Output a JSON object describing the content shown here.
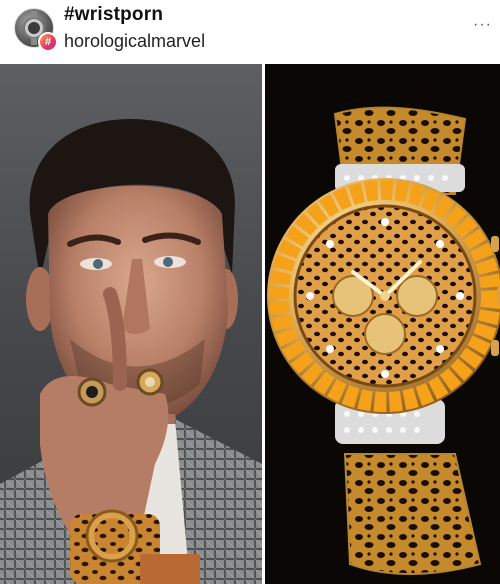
{
  "post": {
    "hashtag": "#wristporn",
    "username": "horologicalmarvel",
    "badge_symbol": "#",
    "more_glyph": "···"
  },
  "images": {
    "left": "man-with-rings-portrait",
    "right": "leopard-dial-gold-watch"
  },
  "colors": {
    "badge_gradient_start": "#f9a23a",
    "badge_gradient_end": "#c62d8c",
    "gold": "#d9a24a",
    "leopard_dark": "#1a0d05"
  }
}
